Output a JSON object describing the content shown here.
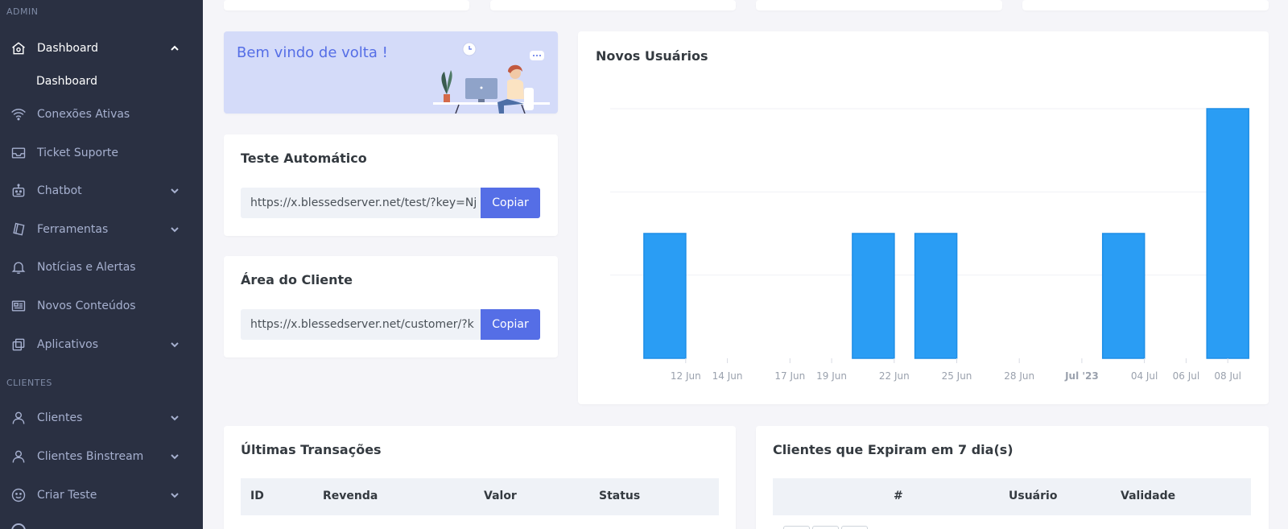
{
  "sidebar": {
    "section_admin": "ADMIN",
    "section_clients": "CLIENTES",
    "dashboard": {
      "label": "Dashboard",
      "icon": "home-icon"
    },
    "dashboard_sub": "Dashboard",
    "items": [
      {
        "label": "Conexões Ativas",
        "icon": "wifi-icon",
        "chevron": false
      },
      {
        "label": "Ticket Suporte",
        "icon": "inbox-icon",
        "chevron": false
      },
      {
        "label": "Chatbot",
        "icon": "robot-icon",
        "chevron": true
      },
      {
        "label": "Ferramentas",
        "icon": "eraser-icon",
        "chevron": true
      },
      {
        "label": "Notícias e Alertas",
        "icon": "bell-icon",
        "chevron": false
      },
      {
        "label": "Novos Conteúdos",
        "icon": "news-icon",
        "chevron": false
      },
      {
        "label": "Aplicativos",
        "icon": "copy-icon",
        "chevron": true
      }
    ],
    "client_items": [
      {
        "label": "Clientes",
        "icon": "user-icon",
        "chevron": true
      },
      {
        "label": "Clientes Binstream",
        "icon": "user-icon",
        "chevron": true
      },
      {
        "label": "Criar Teste",
        "icon": "smile-icon",
        "chevron": true
      }
    ]
  },
  "welcome": {
    "text": "Bem vindo de volta !"
  },
  "auto_test": {
    "title": "Teste Automático",
    "url": "https://x.blessedserver.net/test/?key=Nj",
    "button": "Copiar"
  },
  "client_area": {
    "title": "Área do Cliente",
    "url": "https://x.blessedserver.net/customer/?k",
    "button": "Copiar"
  },
  "transactions": {
    "title": "Últimas Transações",
    "columns": [
      "ID",
      "Revenda",
      "Valor",
      "Status"
    ]
  },
  "expiring": {
    "title": "Clientes que Expiram em 7 dia(s)",
    "columns": [
      "#",
      "Usuário",
      "Validade"
    ]
  },
  "chart_data": {
    "type": "bar",
    "title": "Novos Usuários",
    "bar_color": "#2a9df4",
    "ylim": [
      0,
      3
    ],
    "grid": true,
    "x_ticks": [
      {
        "label": "12 Jun",
        "day": 2,
        "bold": false
      },
      {
        "label": "14 Jun",
        "day": 4,
        "bold": false
      },
      {
        "label": "17 Jun",
        "day": 7,
        "bold": false
      },
      {
        "label": "19 Jun",
        "day": 9,
        "bold": false
      },
      {
        "label": "22 Jun",
        "day": 12,
        "bold": false
      },
      {
        "label": "25 Jun",
        "day": 15,
        "bold": false
      },
      {
        "label": "28 Jun",
        "day": 18,
        "bold": false
      },
      {
        "label": "Jul '23",
        "day": 21,
        "bold": true
      },
      {
        "label": "04 Jul",
        "day": 24,
        "bold": false
      },
      {
        "label": "06 Jul",
        "day": 26,
        "bold": false
      },
      {
        "label": "08 Jul",
        "day": 28,
        "bold": false
      }
    ],
    "bars": [
      {
        "day": 1,
        "value": 1.5
      },
      {
        "day": 11,
        "value": 1.5
      },
      {
        "day": 14,
        "value": 1.5
      },
      {
        "day": 23,
        "value": 1.5
      },
      {
        "day": 28,
        "value": 3
      }
    ]
  },
  "colors": {
    "accent": "#556ee6",
    "sidebar": "#2a3042"
  }
}
